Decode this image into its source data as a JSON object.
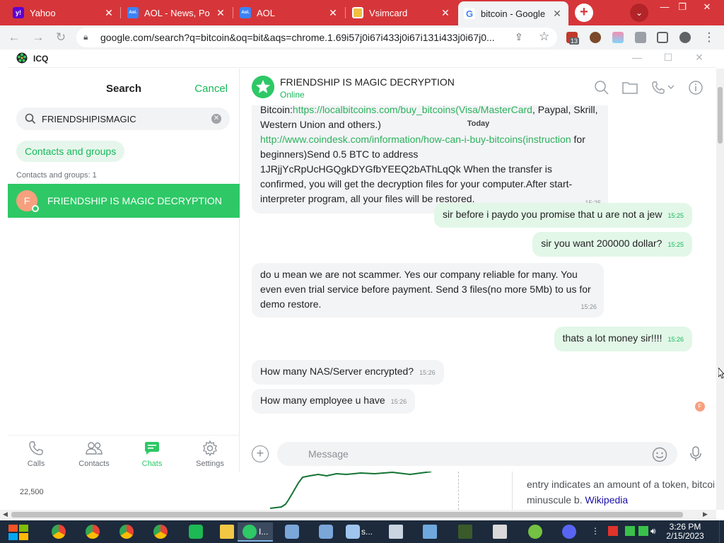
{
  "browser": {
    "tabs": [
      {
        "label": "Yahoo",
        "icon": "yahoo-icon",
        "icon_text": "y!",
        "icon_color": "#5f01d1"
      },
      {
        "label": "AOL - News, Po",
        "icon": "aol-icon",
        "icon_text": "Aol.",
        "icon_color": "#3c82f6"
      },
      {
        "label": "AOL",
        "icon": "aol-icon",
        "icon_text": "Aol.",
        "icon_color": "#3c82f6"
      },
      {
        "label": "Vsimcard",
        "icon": "vsimcard-icon",
        "icon_text": "",
        "icon_color": "#f0c040"
      },
      {
        "label": "bitcoin - Google",
        "icon": "google-icon",
        "icon_text": "G",
        "icon_color": "#4285f4"
      }
    ],
    "address": "google.com/search?q=bitcoin&oq=bit&aqs=chrome.1.69i57j0i67i433j0i67i131i433j0i67j0...",
    "extension_badge": "13",
    "accent": "#d6363a"
  },
  "icq": {
    "app_title": "ICQ",
    "search": {
      "title": "Search",
      "cancel": "Cancel",
      "query": "FRIENDSHIPISMAGIC",
      "filter_chip": "Contacts and groups",
      "section_label": "Contacts and groups: 1",
      "result": {
        "name": "FRIENDSHIP IS MAGIC DECRYPTION",
        "avatar_letter": "F"
      }
    },
    "nav": [
      {
        "label": "Calls",
        "icon": "phone-icon"
      },
      {
        "label": "Contacts",
        "icon": "contacts-icon"
      },
      {
        "label": "Chats",
        "icon": "chats-icon"
      },
      {
        "label": "Settings",
        "icon": "gear-icon"
      }
    ],
    "active_nav": "Chats",
    "chat": {
      "title": "FRIENDSHIP IS MAGIC DECRYPTION",
      "status": "Online",
      "date_divider": "Today",
      "message_placeholder": "Message",
      "mini_avatar_letter": "F",
      "messages": [
        {
          "dir": "in",
          "parts": [
            {
              "text": "Bitcoin:"
            },
            {
              "text": "https://localbitcoins.com/buy_bitcoins(Visa/MasterCard",
              "link": true
            },
            {
              "text": ", Paypal, Skrill, Western Union and others.)"
            },
            {
              "br": true
            },
            {
              "text": "http://www.coindesk.com/information/how-can-i-buy-bitcoins(instruction",
              "link": true
            },
            {
              "text": " for beginners)Send 0.5 BTC to address 1JRjjYcRpUcHGQgkDYGfbYEEQ2bAThLqQk When the transfer is confirmed, you will get the decryption files for your computer.After start-interpreter program, all your files will be restored."
            }
          ],
          "time": "15:25"
        },
        {
          "dir": "out",
          "text": "sir before i paydo you promise that u are not a jew",
          "time": "15:25"
        },
        {
          "dir": "out",
          "text": "sir you want 200000 dollar?",
          "time": "15:25"
        },
        {
          "dir": "in",
          "text": "do u mean we are not scammer. Yes our company reliable for many. You even even trial service before payment. Send 3 files(no more 5Mb) to us for demo restore.",
          "time": "15:26"
        },
        {
          "dir": "out",
          "text": "thats a lot money sir!!!!",
          "time": "15:26"
        },
        {
          "dir": "in",
          "text": "How many NAS/Server encrypted?",
          "time": "15:26"
        },
        {
          "dir": "in",
          "text": "How many employee u have",
          "time": "15:26"
        }
      ]
    },
    "accent": "#2ec866"
  },
  "background_page": {
    "chart_tick": "22,500",
    "wiki_line1": "entry indicates an amount of a token, bitcoin",
    "wiki_line2_prefix": "minuscule b. ",
    "wiki_link": "Wikipedia"
  },
  "taskbar": {
    "running_label_1": "I...",
    "running_label_2": "s...",
    "time": "3:26 PM",
    "date": "2/15/2023"
  }
}
